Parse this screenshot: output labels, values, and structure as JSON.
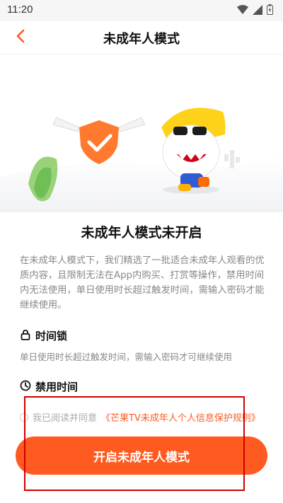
{
  "status": {
    "time": "11:20"
  },
  "header": {
    "title": "未成年人模式"
  },
  "main": {
    "heading": "未成年人模式未开启",
    "description": "在未成年人模式下，我们精选了一批适合未成年人观看的优质内容，且限制无法在App内购买、打赏等操作，禁用时间内无法使用，单日使用时长超过触发时间，需输入密码才能继续使用。",
    "features": [
      {
        "title": "时间锁",
        "desc": "单日使用时长超过触发时间，需输入密码才可继续使用",
        "icon": "lock-icon"
      },
      {
        "title": "禁用时间",
        "desc": "",
        "icon": "clock-icon"
      }
    ]
  },
  "agreement": {
    "prefix": "我已阅读并同意",
    "link": "《芒果TV未成年人个人信息保护规则》"
  },
  "cta": {
    "label": "开启未成年人模式"
  },
  "colors": {
    "accent": "#ff5a1f",
    "highlight": "#d00000"
  }
}
